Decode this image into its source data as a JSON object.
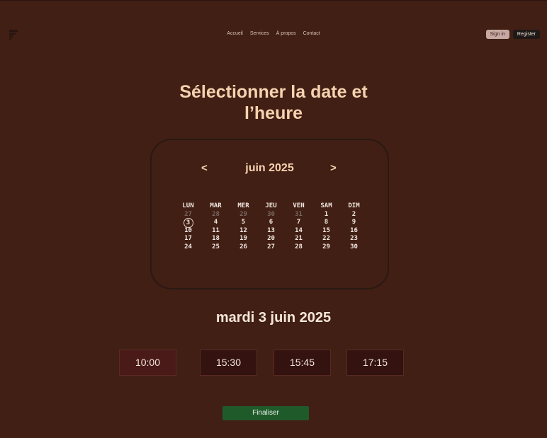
{
  "nav": {
    "items": [
      "Accueil",
      "Services",
      "À propos",
      "Contact"
    ]
  },
  "auth": {
    "signin_label": "Sign in",
    "register_label": "Register"
  },
  "title_line1": "Sélectionner la date et",
  "title_line2": "l’heure",
  "calendar": {
    "prev_label": "<",
    "next_label": ">",
    "month_label": "juin 2025",
    "weekdays": [
      "LUN",
      "MAR",
      "MER",
      "JEU",
      "VEN",
      "SAM",
      "DIM"
    ],
    "weeks": [
      [
        "27",
        "28",
        "29",
        "30",
        "31",
        "1",
        "2"
      ],
      [
        "3",
        "4",
        "5",
        "6",
        "7",
        "8",
        "9"
      ],
      [
        "10",
        "11",
        "12",
        "13",
        "14",
        "15",
        "16"
      ],
      [
        "17",
        "18",
        "19",
        "20",
        "21",
        "22",
        "23"
      ],
      [
        "24",
        "25",
        "26",
        "27",
        "28",
        "29",
        "30"
      ]
    ],
    "muted_first_row_count": 5,
    "selected_day": "3"
  },
  "selected_date_label": "mardi 3 juin 2025",
  "time_slots": [
    "10:00",
    "15:30",
    "15:45",
    "17:15"
  ],
  "active_slot_index": 0,
  "finalize_label": "Finaliser",
  "colors": {
    "background": "#411f14",
    "accent_title": "#f6d2b0",
    "finalize_green": "#1f5b2a"
  }
}
